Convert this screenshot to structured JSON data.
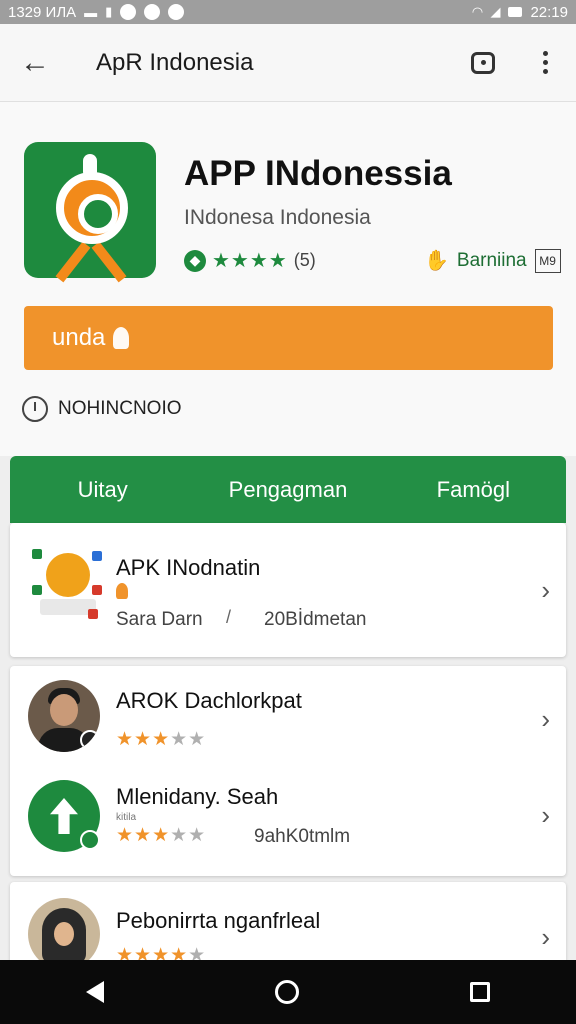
{
  "status_bar": {
    "time_left": "1329 ИЛА",
    "time_right": "22:19"
  },
  "app_bar": {
    "title": "ApR Indonesia",
    "back_icon": "arrow-left-icon",
    "actions": [
      "message-icon",
      "more-vert-icon"
    ]
  },
  "app": {
    "name": "APP INdonessia",
    "developer": "INdonesa Indonesia",
    "rating_stars": 4,
    "rating_count": "(5)",
    "badge_label": "Barniina",
    "badge_box": "M9",
    "install_label": "unda",
    "meta_text": "NOHINCNOIO"
  },
  "tabs": [
    "Uitay",
    "Pengagman",
    "Famögl"
  ],
  "items": [
    {
      "title": "APK INodnatin",
      "sub_left": "Sara Darn",
      "sub_right": "20Bİdmetan"
    },
    {
      "title": "AROK Dachlorkpat",
      "stars": 3
    },
    {
      "title": "Mlenidany. Seah",
      "stars": 3,
      "tag": "kitila",
      "sub_right": "9ahK0tmlm"
    },
    {
      "title": "Pebonirrta nganfrleal",
      "stars": 4
    }
  ],
  "colors": {
    "green": "#238f45",
    "orange": "#f0932b"
  }
}
